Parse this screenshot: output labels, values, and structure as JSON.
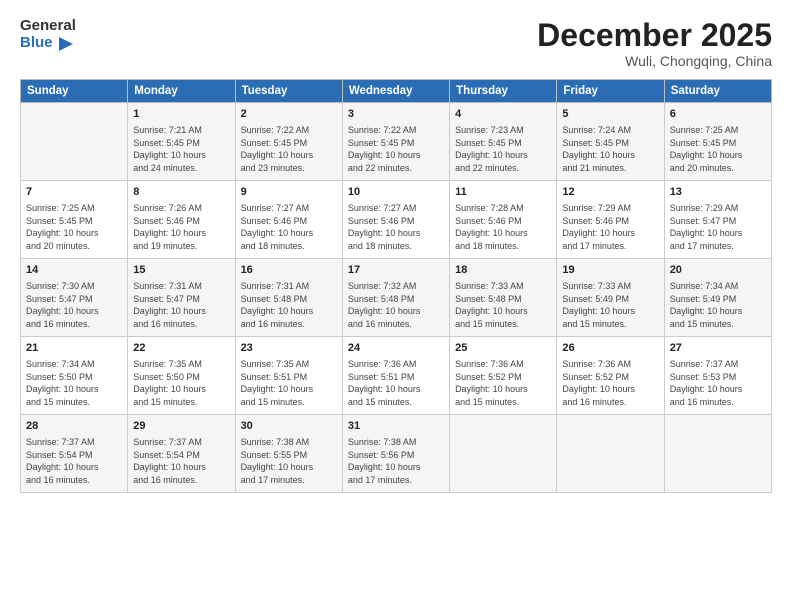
{
  "logo": {
    "line1": "General",
    "line2": "Blue"
  },
  "title": "December 2025",
  "location": "Wuli, Chongqing, China",
  "days_header": [
    "Sunday",
    "Monday",
    "Tuesday",
    "Wednesday",
    "Thursday",
    "Friday",
    "Saturday"
  ],
  "weeks": [
    [
      {
        "day": "",
        "content": ""
      },
      {
        "day": "1",
        "content": "Sunrise: 7:21 AM\nSunset: 5:45 PM\nDaylight: 10 hours\nand 24 minutes."
      },
      {
        "day": "2",
        "content": "Sunrise: 7:22 AM\nSunset: 5:45 PM\nDaylight: 10 hours\nand 23 minutes."
      },
      {
        "day": "3",
        "content": "Sunrise: 7:22 AM\nSunset: 5:45 PM\nDaylight: 10 hours\nand 22 minutes."
      },
      {
        "day": "4",
        "content": "Sunrise: 7:23 AM\nSunset: 5:45 PM\nDaylight: 10 hours\nand 22 minutes."
      },
      {
        "day": "5",
        "content": "Sunrise: 7:24 AM\nSunset: 5:45 PM\nDaylight: 10 hours\nand 21 minutes."
      },
      {
        "day": "6",
        "content": "Sunrise: 7:25 AM\nSunset: 5:45 PM\nDaylight: 10 hours\nand 20 minutes."
      }
    ],
    [
      {
        "day": "7",
        "content": "Sunrise: 7:25 AM\nSunset: 5:45 PM\nDaylight: 10 hours\nand 20 minutes."
      },
      {
        "day": "8",
        "content": "Sunrise: 7:26 AM\nSunset: 5:46 PM\nDaylight: 10 hours\nand 19 minutes."
      },
      {
        "day": "9",
        "content": "Sunrise: 7:27 AM\nSunset: 5:46 PM\nDaylight: 10 hours\nand 18 minutes."
      },
      {
        "day": "10",
        "content": "Sunrise: 7:27 AM\nSunset: 5:46 PM\nDaylight: 10 hours\nand 18 minutes."
      },
      {
        "day": "11",
        "content": "Sunrise: 7:28 AM\nSunset: 5:46 PM\nDaylight: 10 hours\nand 18 minutes."
      },
      {
        "day": "12",
        "content": "Sunrise: 7:29 AM\nSunset: 5:46 PM\nDaylight: 10 hours\nand 17 minutes."
      },
      {
        "day": "13",
        "content": "Sunrise: 7:29 AM\nSunset: 5:47 PM\nDaylight: 10 hours\nand 17 minutes."
      }
    ],
    [
      {
        "day": "14",
        "content": "Sunrise: 7:30 AM\nSunset: 5:47 PM\nDaylight: 10 hours\nand 16 minutes."
      },
      {
        "day": "15",
        "content": "Sunrise: 7:31 AM\nSunset: 5:47 PM\nDaylight: 10 hours\nand 16 minutes."
      },
      {
        "day": "16",
        "content": "Sunrise: 7:31 AM\nSunset: 5:48 PM\nDaylight: 10 hours\nand 16 minutes."
      },
      {
        "day": "17",
        "content": "Sunrise: 7:32 AM\nSunset: 5:48 PM\nDaylight: 10 hours\nand 16 minutes."
      },
      {
        "day": "18",
        "content": "Sunrise: 7:33 AM\nSunset: 5:48 PM\nDaylight: 10 hours\nand 15 minutes."
      },
      {
        "day": "19",
        "content": "Sunrise: 7:33 AM\nSunset: 5:49 PM\nDaylight: 10 hours\nand 15 minutes."
      },
      {
        "day": "20",
        "content": "Sunrise: 7:34 AM\nSunset: 5:49 PM\nDaylight: 10 hours\nand 15 minutes."
      }
    ],
    [
      {
        "day": "21",
        "content": "Sunrise: 7:34 AM\nSunset: 5:50 PM\nDaylight: 10 hours\nand 15 minutes."
      },
      {
        "day": "22",
        "content": "Sunrise: 7:35 AM\nSunset: 5:50 PM\nDaylight: 10 hours\nand 15 minutes."
      },
      {
        "day": "23",
        "content": "Sunrise: 7:35 AM\nSunset: 5:51 PM\nDaylight: 10 hours\nand 15 minutes."
      },
      {
        "day": "24",
        "content": "Sunrise: 7:36 AM\nSunset: 5:51 PM\nDaylight: 10 hours\nand 15 minutes."
      },
      {
        "day": "25",
        "content": "Sunrise: 7:36 AM\nSunset: 5:52 PM\nDaylight: 10 hours\nand 15 minutes."
      },
      {
        "day": "26",
        "content": "Sunrise: 7:36 AM\nSunset: 5:52 PM\nDaylight: 10 hours\nand 16 minutes."
      },
      {
        "day": "27",
        "content": "Sunrise: 7:37 AM\nSunset: 5:53 PM\nDaylight: 10 hours\nand 16 minutes."
      }
    ],
    [
      {
        "day": "28",
        "content": "Sunrise: 7:37 AM\nSunset: 5:54 PM\nDaylight: 10 hours\nand 16 minutes."
      },
      {
        "day": "29",
        "content": "Sunrise: 7:37 AM\nSunset: 5:54 PM\nDaylight: 10 hours\nand 16 minutes."
      },
      {
        "day": "30",
        "content": "Sunrise: 7:38 AM\nSunset: 5:55 PM\nDaylight: 10 hours\nand 17 minutes."
      },
      {
        "day": "31",
        "content": "Sunrise: 7:38 AM\nSunset: 5:56 PM\nDaylight: 10 hours\nand 17 minutes."
      },
      {
        "day": "",
        "content": ""
      },
      {
        "day": "",
        "content": ""
      },
      {
        "day": "",
        "content": ""
      }
    ]
  ]
}
